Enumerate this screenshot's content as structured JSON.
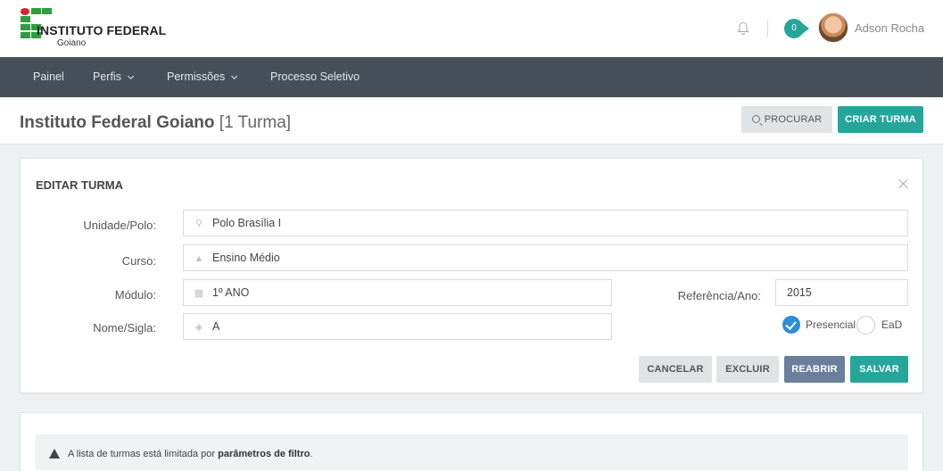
{
  "header": {
    "logo_title": "INSTITUTO FEDERAL",
    "logo_subtitle": "Goiano",
    "notification_count": "0",
    "user_name": "Adson Rocha",
    "icons": [
      "bell-icon",
      "avatar"
    ]
  },
  "nav": {
    "items": [
      {
        "label": "Painel",
        "has_caret": false
      },
      {
        "label": "Perfis",
        "has_caret": true
      },
      {
        "label": "Permissões",
        "has_caret": true
      },
      {
        "label": "Processo Seletivo",
        "has_caret": false
      }
    ]
  },
  "page": {
    "title": "Instituto Federal Goiano",
    "count_label": "[1 Turma]",
    "search_button": "PROCURAR",
    "create_button": "CRIAR TURMA"
  },
  "edit_form": {
    "title": "EDITAR TURMA",
    "fields": {
      "unidade": {
        "label": "Unidade/Polo:",
        "value": "Polo Brasília I",
        "icon": "map-pin-icon"
      },
      "curso": {
        "label": "Curso:",
        "value": "Ensino Médio",
        "icon": "graduation-cap-icon"
      },
      "modulo": {
        "label": "Módulo:",
        "value": "1º ANO",
        "icon": "sitemap-icon"
      },
      "nome": {
        "label": "Nome/Sigla:",
        "value": "A",
        "icon": "tag-icon"
      },
      "referencia": {
        "label": "Referência/Ano:",
        "value": "2015"
      }
    },
    "modalidade": {
      "options": [
        "Presencial",
        "EaD"
      ],
      "selected": "Presencial"
    },
    "buttons": {
      "cancelar": "CANCELAR",
      "excluir": "EXCLUIR",
      "reabrir": "REABRIR",
      "salvar": "SALVAR"
    }
  },
  "list": {
    "alert_prefix": "A lista de turmas está limitada por",
    "alert_bold": "parâmetros de filtro",
    "alert_suffix": "."
  },
  "colors": {
    "accent": "#26a69a",
    "navbar": "#464f58",
    "reabrir": "#6b7e9c",
    "radio": "#2d8fd5",
    "logo_green": "#2e9e3e",
    "logo_red": "#d7262b"
  }
}
